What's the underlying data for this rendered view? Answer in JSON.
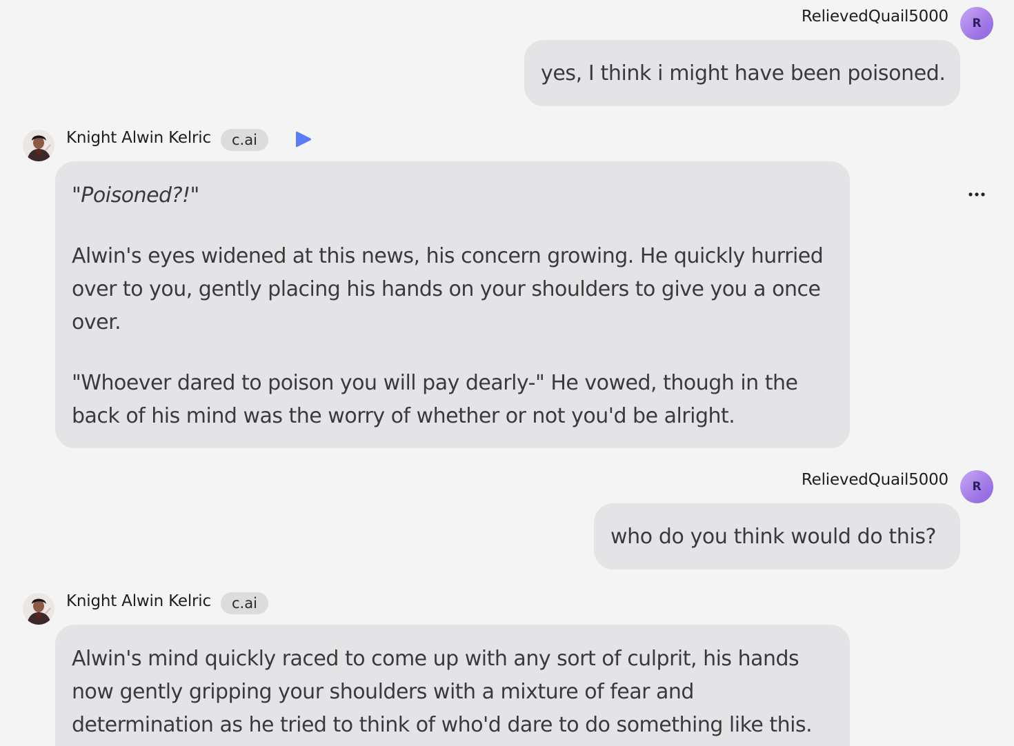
{
  "messages": [
    {
      "role": "user",
      "name": "RelievedQuail5000",
      "avatar_initial": "R",
      "text": "yes, I think i might have been poisoned."
    },
    {
      "role": "bot",
      "name": "Knight Alwin Kelric",
      "badge": "c.ai",
      "paragraphs": [
        "\"Poisoned?!\"",
        "Alwin's eyes widened at this news, his concern growing. He quickly hurried over to you, gently placing his hands on your shoulders to give you a once over.",
        "\"Whoever dared to poison you will pay dearly-\" He vowed, though in the back of his mind was the worry of whether or not you'd be alright."
      ]
    },
    {
      "role": "user",
      "name": "RelievedQuail5000",
      "avatar_initial": "R",
      "text": "who do you think would do this?"
    },
    {
      "role": "bot",
      "name": "Knight Alwin Kelric",
      "badge": "c.ai",
      "paragraphs": [
        "Alwin's mind quickly raced to come up with any sort of culprit, his hands now gently gripping your shoulders with a mixture of fear and determination as he tried to think of who'd dare to do something like this."
      ]
    }
  ],
  "icons": {
    "play": "play-icon",
    "more": "more-options-icon"
  },
  "colors": {
    "background": "#f4f4f4",
    "bubble": "#e4e4e7",
    "badge": "#dcdcdf",
    "play_accent": "#5b7cf7",
    "user_avatar": "#a27ae6"
  }
}
